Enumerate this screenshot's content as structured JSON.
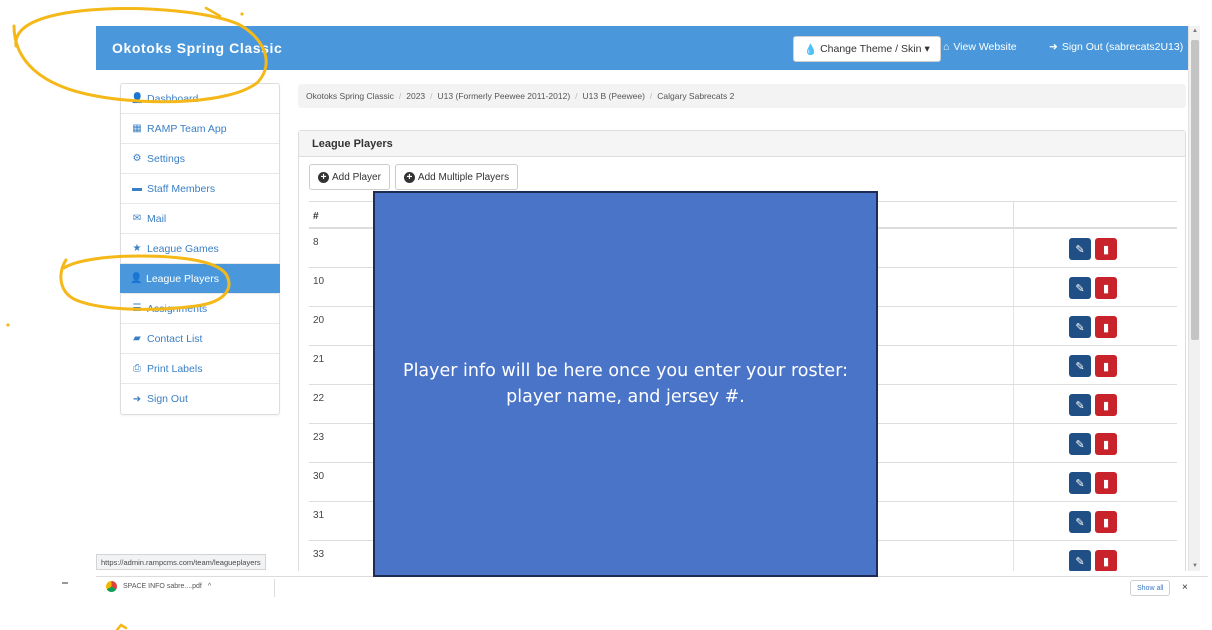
{
  "colors": {
    "topbar": "#4a98db",
    "sidebar_link": "#3a7fc5",
    "active_item": "#4a98db",
    "edit_button": "#1f4f84",
    "delete_button": "#c8232a",
    "overlay_fill": "#4a74c8",
    "overlay_border": "#1d2c55",
    "annotation_circle": "#f5b819"
  },
  "topbar": {
    "brand": "Okotoks Spring Classic",
    "theme_button": "Change Theme / Skin",
    "view_website": "View Website",
    "sign_out": "Sign Out (sabrecats2U13)"
  },
  "sidebar": {
    "items": [
      {
        "label": "Dashboard",
        "icon": "user-icon"
      },
      {
        "label": "RAMP Team App",
        "icon": "grid-icon"
      },
      {
        "label": "Settings",
        "icon": "gear-icon"
      },
      {
        "label": "Staff Members",
        "icon": "briefcase-icon"
      },
      {
        "label": "Mail",
        "icon": "envelope-icon"
      },
      {
        "label": "League Games",
        "icon": "star-icon"
      },
      {
        "label": "League Players",
        "icon": "user-icon"
      },
      {
        "label": "Assignments",
        "icon": "list-icon"
      },
      {
        "label": "Contact List",
        "icon": "comment-icon"
      },
      {
        "label": "Print Labels",
        "icon": "print-icon"
      },
      {
        "label": "Sign Out",
        "icon": "sign-out-icon"
      }
    ]
  },
  "breadcrumb": [
    "Okotoks Spring Classic",
    "2023",
    "U13 (Formerly Peewee 2011-2012)",
    "U13 B (Peewee)",
    "Calgary Sabrecats 2"
  ],
  "panel": {
    "title": "League Players",
    "add_player": "Add Player",
    "add_multiple": "Add Multiple Players"
  },
  "table": {
    "header_number": "#",
    "rows": [
      "8",
      "10",
      "20",
      "21",
      "22",
      "23",
      "30",
      "31",
      "33"
    ]
  },
  "status_url": "https://admin.rampcms.com/team/leagueplayers",
  "overlay_text": "Player info will be here once you enter your roster: player name, and jersey #.",
  "downloads": {
    "file": "SPACE INFO sabre....pdf",
    "show_all": "Show all",
    "close": "×"
  }
}
